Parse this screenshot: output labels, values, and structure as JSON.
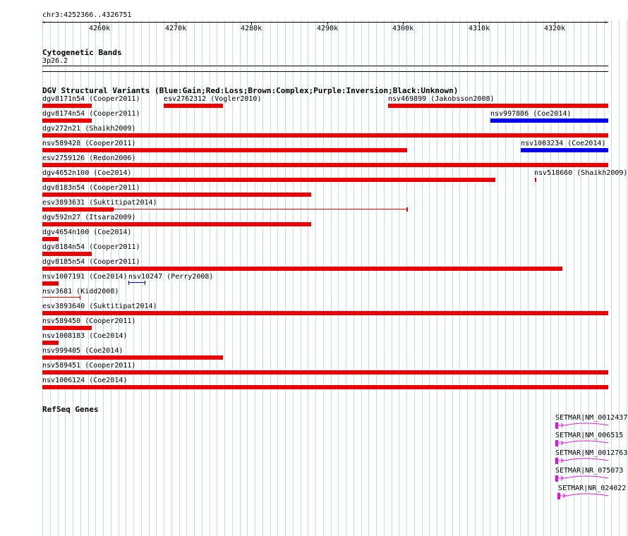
{
  "region": "chr3:4252366..4326751",
  "axis": {
    "ticks": [
      "4260k",
      "4270k",
      "4280k",
      "4290k",
      "4300k",
      "4310k",
      "4320k"
    ]
  },
  "cytoband": {
    "title": "Cytogenetic Bands",
    "band": "3p26.2"
  },
  "dgv": {
    "title": "DGV Structural Variants (Blue:Gain;Red:Loss;Brown:Complex;Purple:Inversion;Black:Unknown)",
    "colors": {
      "gain": "#0000ee",
      "loss": "#ee0000"
    },
    "features": [
      {
        "label": "dgv8171n54 (Cooper2011)",
        "type": "loss"
      },
      {
        "label": "esv2762312 (Vogler2010)",
        "type": "loss"
      },
      {
        "label": "nsv469899 (Jakobsson2008)",
        "type": "loss"
      },
      {
        "label": "dgv8174n54 (Cooper2011)",
        "type": "loss"
      },
      {
        "label": "nsv997886 (Coe2014)",
        "type": "gain"
      },
      {
        "label": "dgv272n21 (Shaikh2009)",
        "type": "loss"
      },
      {
        "label": "nsv589428 (Cooper2011)",
        "type": "loss"
      },
      {
        "label": "nsv1003234 (Coe2014)",
        "type": "gain"
      },
      {
        "label": "esv2759126 (Redon2006)",
        "type": "loss"
      },
      {
        "label": "dgv4652n100 (Coe2014)",
        "type": "loss"
      },
      {
        "label": "nsv518660 (Shaikh2009)",
        "type": "loss"
      },
      {
        "label": "dgv8183n54 (Cooper2011)",
        "type": "loss"
      },
      {
        "label": "esv3893631 (Suktitipat2014)",
        "type": "loss"
      },
      {
        "label": "dgv592n27 (Itsara2009)",
        "type": "loss"
      },
      {
        "label": "dgv4654n100 (Coe2014)",
        "type": "loss"
      },
      {
        "label": "dgv8184n54 (Cooper2011)",
        "type": "loss"
      },
      {
        "label": "dgv8185n54 (Cooper2011)",
        "type": "loss"
      },
      {
        "label": "nsv1007191 (Coe2014)",
        "type": "loss"
      },
      {
        "label": "nsv10247 (Perry2008)",
        "type": "gain"
      },
      {
        "label": "nsv3681 (Kidd2008)",
        "type": "loss"
      },
      {
        "label": "esv3893640 (Suktitipat2014)",
        "type": "loss"
      },
      {
        "label": "nsv589450 (Cooper2011)",
        "type": "loss"
      },
      {
        "label": "nsv1008183 (Coe2014)",
        "type": "loss"
      },
      {
        "label": "nsv999405 (Coe2014)",
        "type": "loss"
      },
      {
        "label": "nsv589451 (Cooper2011)",
        "type": "loss"
      },
      {
        "label": "nsv1006124 (Coe2014)",
        "type": "loss"
      }
    ]
  },
  "refseq": {
    "title": "RefSeq Genes",
    "color": "#dd11dd",
    "genes": [
      "SETMAR|NM_0012437",
      "SETMAR|NM_006515",
      "SETMAR|NM_0012763",
      "SETMAR|NR_075073",
      "SETMAR|NR_024022"
    ]
  }
}
